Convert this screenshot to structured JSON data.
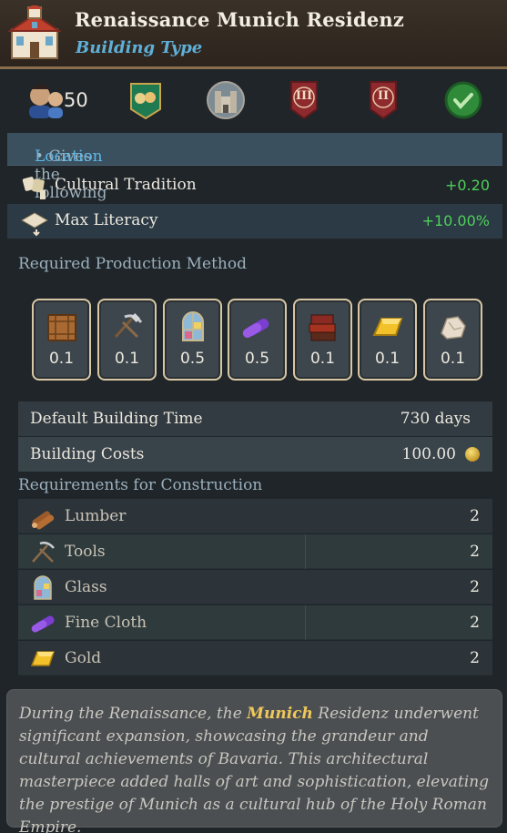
{
  "header": {
    "title": "Renaissance Munich Residenz",
    "subtitle": "Building Type",
    "icon": "building-icon"
  },
  "stats": {
    "population_value": "50",
    "icons": [
      "people-icon",
      "banner-icon",
      "castle-icon",
      "rank-iii-icon",
      "rank-ii-icon",
      "check-icon"
    ],
    "rank_iii": "III",
    "rank_ii": "II"
  },
  "benefits": {
    "intro": "• Gives the following benefits to its ",
    "location_link": "Location",
    "rows": [
      {
        "label": "Cultural Tradition",
        "value": "+0.20",
        "icon": "culture-icon"
      },
      {
        "label": "Max Literacy",
        "value": "+10.00%",
        "icon": "literacy-icon"
      }
    ]
  },
  "production": {
    "label": "Required Production Method",
    "items": [
      {
        "icon": "crate-icon",
        "value": "0.1"
      },
      {
        "icon": "tools-icon",
        "value": "0.1"
      },
      {
        "icon": "glass-icon",
        "value": "0.5"
      },
      {
        "icon": "cloth-icon",
        "value": "0.5"
      },
      {
        "icon": "books-icon",
        "value": "0.1"
      },
      {
        "icon": "gold-icon",
        "value": "0.1"
      },
      {
        "icon": "marble-icon",
        "value": "0.1"
      }
    ]
  },
  "info": {
    "build_time_label": "Default Building Time",
    "build_time_value": "730 days",
    "cost_label": "Building Costs",
    "cost_value": "100.00"
  },
  "requirements": {
    "label": "Requirements for Construction",
    "items": [
      {
        "name": "Lumber",
        "count": "2",
        "icon": "lumber-icon"
      },
      {
        "name": "Tools",
        "count": "2",
        "icon": "tools-icon"
      },
      {
        "name": "Glass",
        "count": "2",
        "icon": "glass-icon"
      },
      {
        "name": "Fine Cloth",
        "count": "2",
        "icon": "cloth-icon"
      },
      {
        "name": "Gold",
        "count": "2",
        "icon": "gold-icon"
      }
    ]
  },
  "description": {
    "part1": "During the Renaissance, the ",
    "highlight": "Munich",
    "part2": " Residenz underwent significant expansion, showcasing the grandeur and cultural achievements of Bavaria. This architectural masterpiece added halls of art and sophistication, elevating the prestige of Munich as a cultural hub of the Holy Roman Empire."
  },
  "colors": {
    "positive": "#4fd05a",
    "link": "#5fb6e6",
    "highlight": "#f0c75a"
  }
}
